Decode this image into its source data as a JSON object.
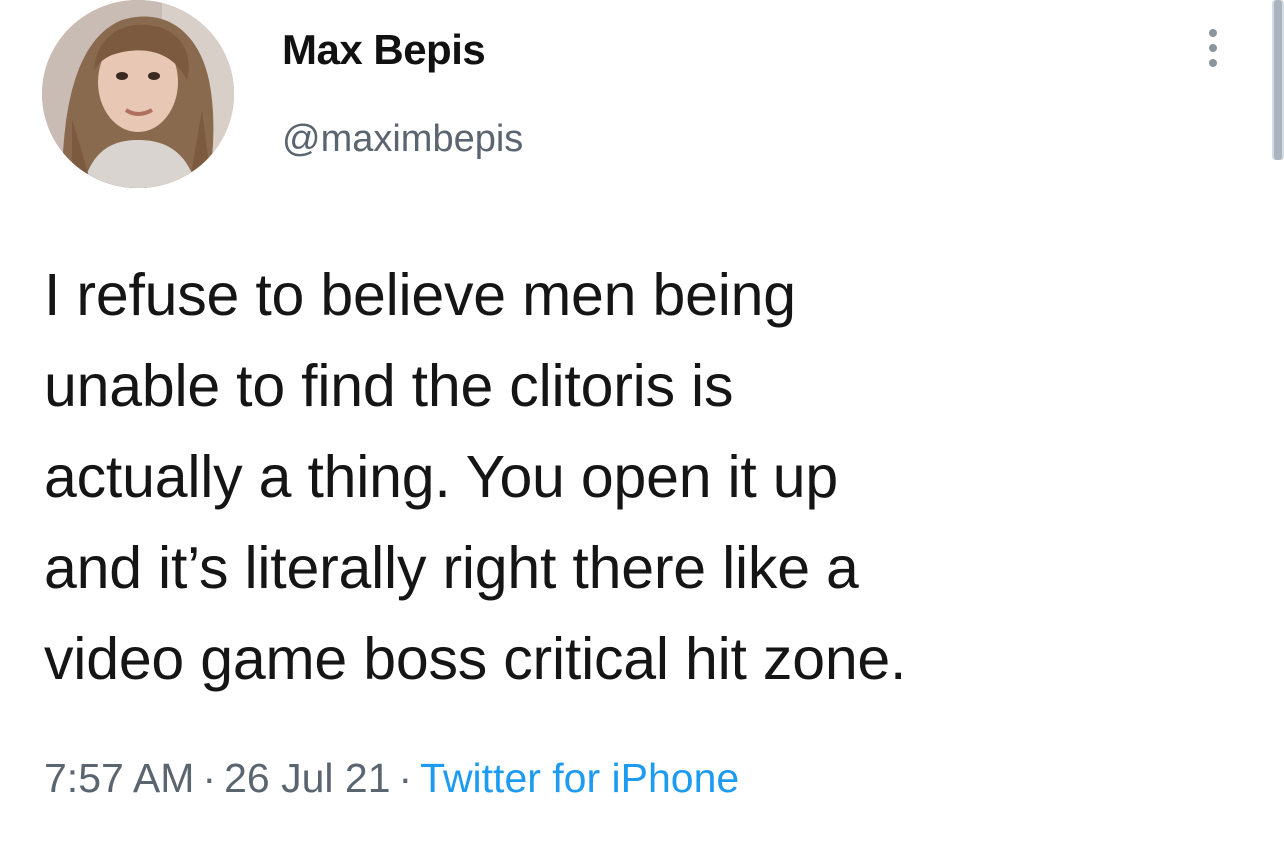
{
  "tweet": {
    "author": {
      "display_name": "Max Bepis",
      "handle": "@maximbepis",
      "avatar_icon": "profile-photo"
    },
    "more_icon": "more-vertical-icon",
    "text": "I refuse to believe men being\nunable to find the clitoris is\nactually a thing. You open it up\nand it’s literally right there like a\nvideo game boss critical hit zone.",
    "time": "7:57 AM",
    "separator": "·",
    "date": "26 Jul 21",
    "source": "Twitter for iPhone"
  },
  "colors": {
    "text": "#151515",
    "secondary": "#5b6570",
    "link": "#1d9bf0",
    "background": "#ffffff"
  }
}
